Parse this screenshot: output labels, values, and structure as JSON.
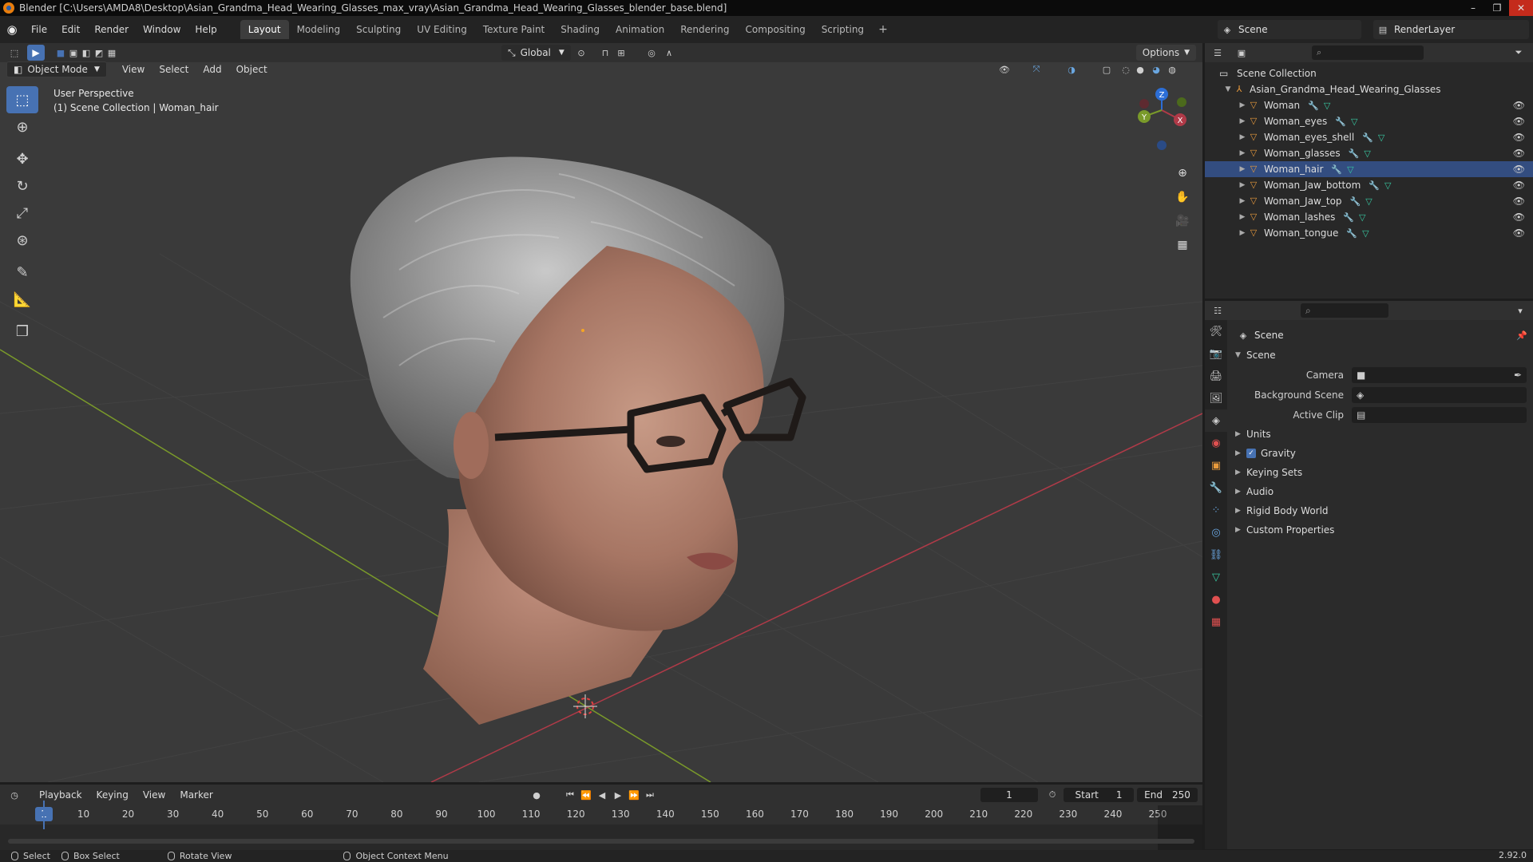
{
  "window": {
    "title": "Blender [C:\\Users\\AMDA8\\Desktop\\Asian_Grandma_Head_Wearing_Glasses_max_vray\\Asian_Grandma_Head_Wearing_Glasses_blender_base.blend]",
    "minimize": "–",
    "maximize": "❐",
    "close": "✕"
  },
  "menu": {
    "items": [
      "File",
      "Edit",
      "Render",
      "Window",
      "Help"
    ]
  },
  "workspaces": {
    "tabs": [
      "Layout",
      "Modeling",
      "Sculpting",
      "UV Editing",
      "Texture Paint",
      "Shading",
      "Animation",
      "Rendering",
      "Compositing",
      "Scripting"
    ],
    "active": "Layout",
    "add": "+"
  },
  "scene": {
    "name": "Scene",
    "render_layer": "RenderLayer"
  },
  "viewport_header": {
    "mode": "Object Mode",
    "menus": [
      "View",
      "Select",
      "Add",
      "Object"
    ],
    "orientation": "Global",
    "options": "Options"
  },
  "viewport": {
    "perspective": "User Perspective",
    "collection_info": "(1) Scene Collection | Woman_hair",
    "gizmo_axes": {
      "z": "Z",
      "y": "Y",
      "x": "X"
    },
    "colors": {
      "background": "#3a3a3a",
      "x_axis": "#b03a48",
      "y_axis": "#7a9a2a",
      "z_axis": "#2c6ed6"
    }
  },
  "tools": [
    "select-box",
    "cursor",
    "move",
    "rotate",
    "scale",
    "transform",
    "annotate",
    "measure",
    "add-cube"
  ],
  "outliner": {
    "root": "Scene Collection",
    "collection": "Asian_Grandma_Head_Wearing_Glasses",
    "objects": [
      {
        "name": "Woman",
        "selected": false
      },
      {
        "name": "Woman_eyes",
        "selected": false
      },
      {
        "name": "Woman_eyes_shell",
        "selected": false
      },
      {
        "name": "Woman_glasses",
        "selected": false
      },
      {
        "name": "Woman_hair",
        "selected": true
      },
      {
        "name": "Woman_Jaw_bottom",
        "selected": false
      },
      {
        "name": "Woman_Jaw_top",
        "selected": false
      },
      {
        "name": "Woman_lashes",
        "selected": false
      },
      {
        "name": "Woman_tongue",
        "selected": false
      }
    ]
  },
  "properties": {
    "context_title": "Scene",
    "panel_title": "Scene",
    "fields": [
      {
        "label": "Camera",
        "value": ""
      },
      {
        "label": "Background Scene",
        "value": ""
      },
      {
        "label": "Active Clip",
        "value": ""
      }
    ],
    "panels": [
      {
        "label": "Units",
        "checkbox": false
      },
      {
        "label": "Gravity",
        "checkbox": true
      },
      {
        "label": "Keying Sets",
        "checkbox": false
      },
      {
        "label": "Audio",
        "checkbox": false
      },
      {
        "label": "Rigid Body World",
        "checkbox": false
      },
      {
        "label": "Custom Properties",
        "checkbox": false
      }
    ]
  },
  "timeline": {
    "menus": [
      "Playback",
      "Keying",
      "View",
      "Marker"
    ],
    "current_frame": "1",
    "start_label": "Start",
    "start": "1",
    "end_label": "End",
    "end": "250",
    "ticks": [
      "1",
      "10",
      "20",
      "30",
      "40",
      "50",
      "60",
      "70",
      "80",
      "90",
      "100",
      "110",
      "120",
      "130",
      "140",
      "150",
      "160",
      "170",
      "180",
      "190",
      "200",
      "210",
      "220",
      "230",
      "240",
      "250"
    ]
  },
  "statusbar": {
    "items": [
      "Select",
      "Box Select",
      "Rotate View",
      "Object Context Menu"
    ],
    "version": "2.92.0"
  }
}
